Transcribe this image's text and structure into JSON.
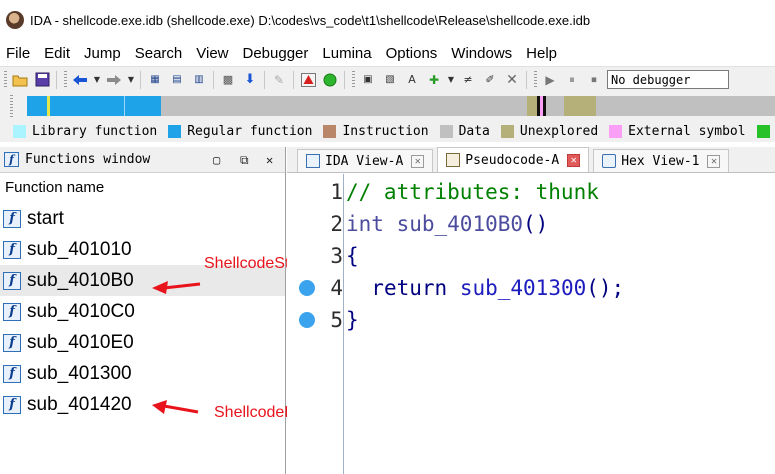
{
  "window": {
    "title": "IDA - shellcode.exe.idb (shellcode.exe) D:\\codes\\vs_code\\t1\\shellcode\\Release\\shellcode.exe.idb"
  },
  "menu": [
    "File",
    "Edit",
    "Jump",
    "Search",
    "View",
    "Debugger",
    "Lumina",
    "Options",
    "Windows",
    "Help"
  ],
  "toolbar": {
    "debugger_select": "No debugger"
  },
  "legend": [
    {
      "label": "Library function",
      "color": "#aaf4ff"
    },
    {
      "label": "Regular function",
      "color": "#1ea3e8"
    },
    {
      "label": "Instruction",
      "color": "#b9866a"
    },
    {
      "label": "Data",
      "color": "#c0c0c0"
    },
    {
      "label": "Unexplored",
      "color": "#b5b07a"
    },
    {
      "label": "External symbol",
      "color": "#fb9ef5"
    },
    {
      "label": "",
      "color": "#27c227"
    }
  ],
  "functions_window": {
    "title": "Functions window",
    "column_header": "Function name",
    "selected_index": 2,
    "functions": [
      "start",
      "sub_401010",
      "sub_4010B0",
      "sub_4010C0",
      "sub_4010E0",
      "sub_401300",
      "sub_401420"
    ]
  },
  "annotations": {
    "start_label": "ShellcodeStart",
    "end_label": "ShellcodeEnd",
    "color": "#e8131b"
  },
  "tabs": [
    {
      "label": "IDA View-A",
      "active": false
    },
    {
      "label": "Pseudocode-A",
      "active": true
    },
    {
      "label": "Hex View-1",
      "active": false
    }
  ],
  "code": {
    "lines": [
      {
        "number": "1",
        "breakpoint": false,
        "text": "// attributes: thunk"
      },
      {
        "number": "2",
        "breakpoint": false,
        "text": "int sub_4010B0()"
      },
      {
        "number": "3",
        "breakpoint": false,
        "text": "{"
      },
      {
        "number": "4",
        "breakpoint": true,
        "text": "  return sub_401300();"
      },
      {
        "number": "5",
        "breakpoint": true,
        "text": "}"
      }
    ],
    "tokens": {
      "comment": "// attributes: thunk",
      "kw_int": "int",
      "func_name": "sub_4010B0",
      "parens": "()",
      "open_brace": "{",
      "kw_return": "return",
      "callee": "sub_401300",
      "call_tail": "();",
      "close_brace": "}"
    }
  }
}
